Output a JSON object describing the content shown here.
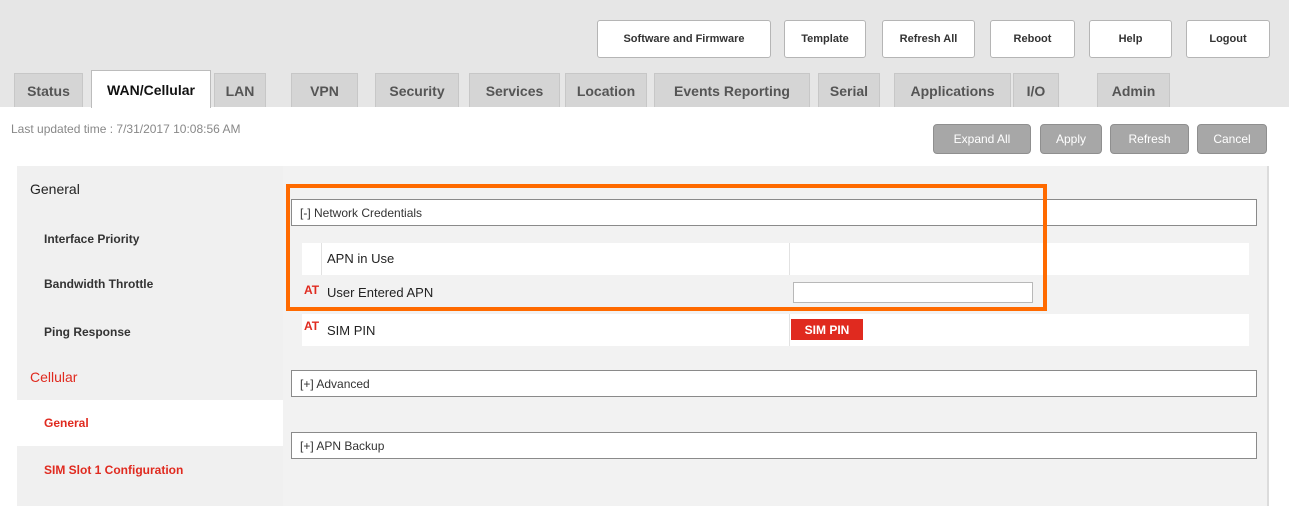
{
  "header": {
    "buttons": [
      "Software and Firmware",
      "Template",
      "Refresh All",
      "Reboot",
      "Help",
      "Logout"
    ]
  },
  "tabs": [
    {
      "label": "Status",
      "active": false
    },
    {
      "label": "WAN/Cellular",
      "active": true
    },
    {
      "label": "LAN",
      "active": false
    },
    {
      "label": "VPN",
      "active": false
    },
    {
      "label": "Security",
      "active": false
    },
    {
      "label": "Services",
      "active": false
    },
    {
      "label": "Location",
      "active": false
    },
    {
      "label": "Events Reporting",
      "active": false
    },
    {
      "label": "Serial",
      "active": false
    },
    {
      "label": "Applications",
      "active": false
    },
    {
      "label": "I/O",
      "active": false
    },
    {
      "label": "Admin",
      "active": false
    }
  ],
  "status": {
    "last_updated": "Last updated time : 7/31/2017 10:08:56 AM"
  },
  "actions": [
    "Expand All",
    "Apply",
    "Refresh",
    "Cancel"
  ],
  "sidebar": {
    "items": [
      {
        "label": "General"
      },
      {
        "label": "Interface Priority"
      },
      {
        "label": "Bandwidth Throttle"
      },
      {
        "label": "Ping Response"
      },
      {
        "label": "Cellular"
      },
      {
        "label": "General"
      },
      {
        "label": "SIM Slot 1 Configuration"
      }
    ]
  },
  "content": {
    "network_credentials": {
      "header": "[-] Network Credentials",
      "apn_in_use_label": "APN in Use",
      "apn_in_use_value": "",
      "user_apn_marker": "AT",
      "user_apn_label": "User Entered APN",
      "user_apn_value": "",
      "sim_pin_marker": "AT",
      "sim_pin_label": "SIM PIN",
      "sim_pin_button": "SIM PIN"
    },
    "advanced_header": "[+] Advanced",
    "apn_backup_header": "[+] APN Backup"
  },
  "colors": {
    "accent_red": "#e02a1f",
    "highlight_orange": "#ff6a00",
    "action_button_gray": "#a7a7a7"
  }
}
